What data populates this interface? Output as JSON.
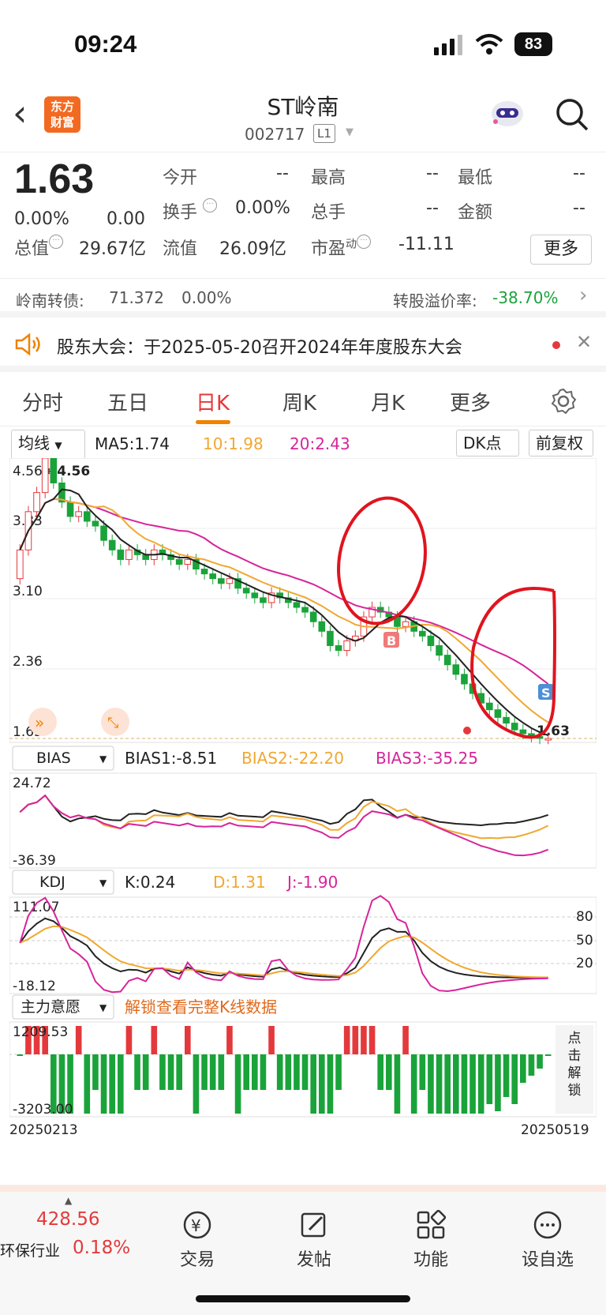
{
  "status": {
    "time": "09:24",
    "battery": "83"
  },
  "header": {
    "logo_line1": "东方",
    "logo_line2": "财富",
    "name": "ST岭南",
    "code": "002717",
    "level": "L1"
  },
  "quote": {
    "price": "1.63",
    "change_pct": "0.00%",
    "change": "0.00",
    "open_lbl": "今开",
    "open": "--",
    "high_lbl": "最高",
    "high": "--",
    "low_lbl": "最低",
    "low": "--",
    "turnover_lbl": "换手",
    "turnover": "0.00%",
    "volume_lbl": "总手",
    "volume": "--",
    "amount_lbl": "金额",
    "amount": "--",
    "mcap_lbl": "总值",
    "mcap": "29.67亿",
    "float_lbl": "流值",
    "float": "26.09亿",
    "pe_lbl": "市盈",
    "pe_sup": "动",
    "pe": "-11.11",
    "more": "更多"
  },
  "convert": {
    "label": "岭南转债:",
    "price": "71.372",
    "pct": "0.00%",
    "premium_lbl": "转股溢价率:",
    "premium": "-38.70%"
  },
  "notice": {
    "text": "股东大会：于2025-05-20召开2024年年度股东大会"
  },
  "tabs": [
    "分时",
    "五日",
    "日K",
    "周K",
    "月K",
    "更多"
  ],
  "toolbar": {
    "ma_select": "均线",
    "ma5": "MA5:1.74",
    "ma10": "10:1.98",
    "ma20": "20:2.43",
    "dk": "DK点",
    "adjust": "前复权"
  },
  "kline": {
    "y_top": "4.56",
    "y_mid1": "3.83",
    "y_mid2": "3.10",
    "y_mid3": "2.36",
    "y_bot": "1.63",
    "max_label": "←4.56",
    "last_label": "1.63",
    "b_mark": "B",
    "s_mark": "S"
  },
  "bias": {
    "select": "BIAS",
    "b1": "BIAS1:-8.51",
    "b2": "BIAS2:-22.20",
    "b3": "BIAS3:-35.25",
    "y_top": "24.72",
    "y_bot": "-36.39"
  },
  "kdj": {
    "select": "KDJ",
    "k": "K:0.24",
    "d": "D:1.31",
    "j": "J:-1.90",
    "y_top": "111.07",
    "y_bot": "-18.12",
    "l80": "80",
    "l50": "50",
    "l20": "20"
  },
  "mainforce": {
    "select": "主力意愿",
    "unlock": "解锁查看完整K线数据",
    "y_top": "1209.53",
    "y_bot": "-3203.00",
    "side": "点击解锁"
  },
  "dates": {
    "start": "20250213",
    "end": "20250519"
  },
  "nav": {
    "index_val": "428.56",
    "index_name": "环保行业",
    "index_pct": "0.18%",
    "trade": "交易",
    "post": "发帖",
    "func": "功能",
    "watch": "设自选"
  },
  "colors": {
    "up": "#e4393c",
    "down": "#1aa33a",
    "ma5": "#222222",
    "ma10": "#f0a830",
    "ma20": "#d6259a",
    "accent": "#f08200"
  }
}
